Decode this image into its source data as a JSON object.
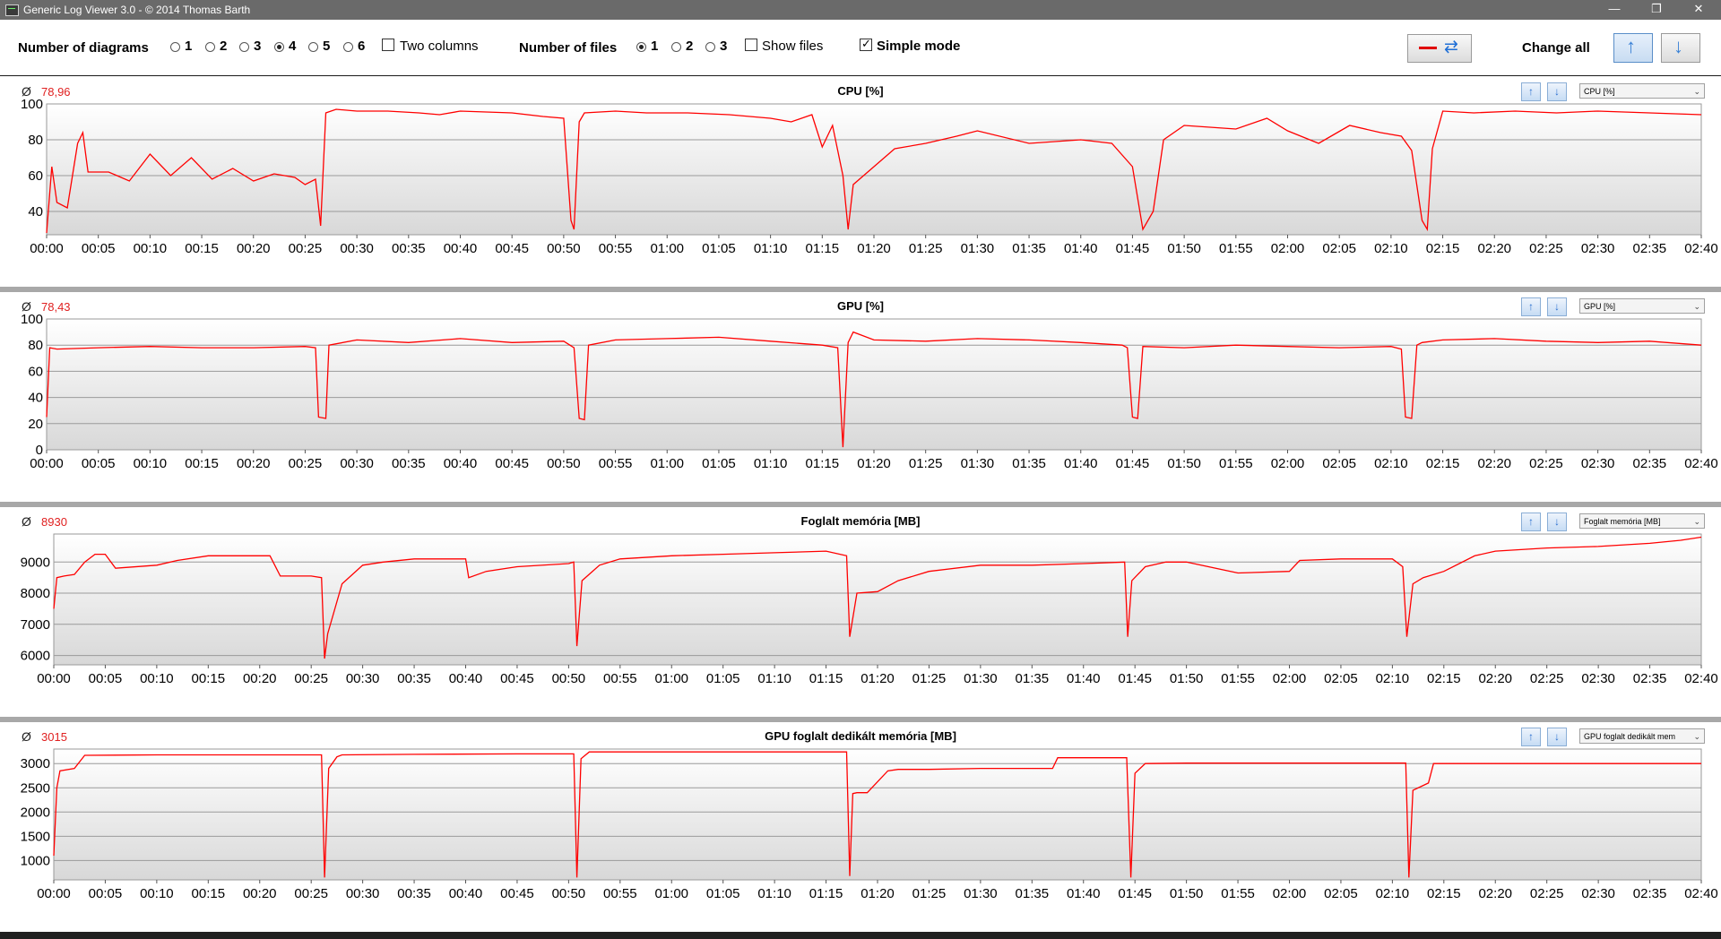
{
  "window": {
    "title": "Generic Log Viewer 3.0 - © 2014 Thomas Barth",
    "minimize": "—",
    "maximize": "❐",
    "close": "✕"
  },
  "toolbar": {
    "diagrams_label": "Number of diagrams",
    "diagram_options": [
      "1",
      "2",
      "3",
      "4",
      "5",
      "6"
    ],
    "diagram_selected": "4",
    "two_columns_label": "Two columns",
    "two_columns_checked": false,
    "files_label": "Number of files",
    "file_options": [
      "1",
      "2",
      "3"
    ],
    "file_selected": "1",
    "show_files_label": "Show files",
    "show_files_checked": false,
    "simple_mode_label": "Simple mode",
    "simple_mode_checked": true,
    "change_all_label": "Change all"
  },
  "colors": {
    "series": "#ff0000",
    "avg": "#e02020",
    "grid": "#9a9a9a",
    "separator": "#a8a8a8"
  },
  "avg_symbol": "Ø",
  "time_ticks": [
    "00:00",
    "00:05",
    "00:10",
    "00:15",
    "00:20",
    "00:25",
    "00:30",
    "00:35",
    "00:40",
    "00:45",
    "00:50",
    "00:55",
    "01:00",
    "01:05",
    "01:10",
    "01:15",
    "01:20",
    "01:25",
    "01:30",
    "01:35",
    "01:40",
    "01:45",
    "01:50",
    "01:55",
    "02:00",
    "02:05",
    "02:10",
    "02:15",
    "02:20",
    "02:25",
    "02:30",
    "02:35",
    "02:40"
  ],
  "panels": [
    {
      "title": "CPU [%]",
      "avg": "78,96",
      "combo": "CPU [%]"
    },
    {
      "title": "GPU [%]",
      "avg": "78,43",
      "combo": "GPU [%]"
    },
    {
      "title": "Foglalt memória [MB]",
      "avg": "8930",
      "combo": "Foglalt memória [MB]"
    },
    {
      "title": "GPU foglalt dedikált memória [MB]",
      "avg": "3015",
      "combo": "GPU foglalt dedikált mem"
    }
  ],
  "chart_data": [
    {
      "type": "line",
      "title": "CPU [%]",
      "x_unit": "minutes",
      "ylim": [
        27,
        100
      ],
      "yticks": [
        40,
        60,
        80,
        100
      ],
      "grid": true,
      "series": [
        {
          "name": "CPU [%]",
          "x": [
            0,
            0.5,
            1,
            2,
            3,
            3.5,
            4,
            6,
            8,
            10,
            12,
            14,
            16,
            18,
            20,
            22,
            24,
            25,
            26,
            26.5,
            27,
            28,
            30,
            33,
            36,
            38,
            40,
            45,
            48,
            50,
            50.7,
            51,
            51.5,
            52,
            55,
            58,
            62,
            66,
            70,
            72,
            74,
            75,
            76,
            77,
            77.5,
            78,
            80,
            82,
            85,
            88,
            90,
            95,
            100,
            103,
            105,
            106,
            107,
            108,
            110,
            115,
            118,
            120,
            123,
            126,
            129,
            131,
            132,
            133,
            133.5,
            134,
            135,
            138,
            142,
            146,
            150,
            155,
            160
          ],
          "values": [
            28,
            65,
            45,
            42,
            78,
            84,
            62,
            62,
            57,
            72,
            60,
            70,
            58,
            64,
            57,
            61,
            59,
            55,
            58,
            32,
            95,
            97,
            96,
            96,
            95,
            94,
            96,
            95,
            93,
            92,
            35,
            30,
            90,
            95,
            96,
            95,
            95,
            94,
            92,
            90,
            94,
            76,
            88,
            60,
            30,
            55,
            65,
            75,
            78,
            82,
            85,
            78,
            80,
            78,
            65,
            30,
            40,
            80,
            88,
            86,
            92,
            85,
            78,
            88,
            84,
            82,
            74,
            35,
            30,
            75,
            96,
            95,
            96,
            95,
            96,
            95,
            94
          ]
        }
      ]
    },
    {
      "type": "line",
      "title": "GPU [%]",
      "x_unit": "minutes",
      "ylim": [
        0,
        100
      ],
      "yticks": [
        0,
        20,
        40,
        60,
        80,
        100
      ],
      "grid": true,
      "series": [
        {
          "name": "GPU [%]",
          "x": [
            0,
            0.3,
            1,
            5,
            10,
            15,
            20,
            25,
            26,
            26.3,
            27,
            27.3,
            30,
            35,
            40,
            45,
            50,
            51,
            51.5,
            52,
            52.4,
            55,
            60,
            65,
            70,
            75,
            76.5,
            77,
            77.5,
            78,
            80,
            85,
            90,
            95,
            100,
            104,
            104.5,
            105,
            105.5,
            106,
            110,
            115,
            120,
            125,
            130,
            131,
            131.4,
            132,
            132.5,
            133,
            135,
            140,
            145,
            150,
            155,
            160
          ],
          "values": [
            25,
            78,
            77,
            78,
            79,
            78,
            78,
            79,
            78,
            25,
            24,
            80,
            84,
            82,
            85,
            82,
            83,
            78,
            24,
            23,
            80,
            84,
            85,
            86,
            83,
            80,
            78,
            2,
            82,
            90,
            84,
            83,
            85,
            84,
            82,
            80,
            78,
            25,
            24,
            79,
            78,
            80,
            79,
            78,
            79,
            77,
            25,
            24,
            80,
            82,
            84,
            85,
            83,
            82,
            83,
            80
          ]
        }
      ]
    },
    {
      "type": "line",
      "title": "Foglalt memória [MB]",
      "x_unit": "minutes",
      "ylim": [
        5700,
        9900
      ],
      "yticks": [
        6000,
        7000,
        8000,
        9000
      ],
      "grid": true,
      "series": [
        {
          "name": "Foglalt memória [MB]",
          "x": [
            0,
            0.3,
            1,
            2,
            3,
            4,
            5,
            6,
            10,
            12,
            15,
            20,
            21,
            22,
            24,
            25,
            26,
            26.3,
            26.6,
            28,
            30,
            32,
            35,
            40,
            40.3,
            42,
            45,
            50,
            50.5,
            50.8,
            51.3,
            53,
            55,
            60,
            65,
            70,
            75,
            77,
            77.3,
            78,
            80,
            82,
            85,
            90,
            95,
            100,
            104,
            104.3,
            104.7,
            106,
            108,
            110,
            115,
            120,
            121,
            125,
            130,
            131,
            131.4,
            132,
            133,
            135,
            138,
            140,
            145,
            150,
            155,
            158,
            160
          ],
          "values": [
            7500,
            8500,
            8550,
            8600,
            9000,
            9250,
            9250,
            8800,
            8900,
            9050,
            9200,
            9200,
            9200,
            8550,
            8550,
            8550,
            8500,
            5900,
            6700,
            8300,
            8900,
            9000,
            9100,
            9100,
            8500,
            8700,
            8850,
            8950,
            9000,
            6300,
            8400,
            8900,
            9100,
            9200,
            9250,
            9300,
            9350,
            9200,
            6600,
            8000,
            8050,
            8400,
            8700,
            8900,
            8900,
            8950,
            9000,
            6600,
            8400,
            8850,
            9000,
            9000,
            8650,
            8700,
            9050,
            9100,
            9100,
            8850,
            6600,
            8300,
            8500,
            8700,
            9200,
            9350,
            9450,
            9500,
            9600,
            9700,
            9800
          ]
        }
      ]
    },
    {
      "type": "line",
      "title": "GPU foglalt dedikált memória [MB]",
      "x_unit": "minutes",
      "ylim": [
        600,
        3300
      ],
      "yticks": [
        1000,
        1500,
        2000,
        2500,
        3000
      ],
      "grid": true,
      "series": [
        {
          "name": "GPU foglalt dedikált memória [MB]",
          "x": [
            0,
            0.3,
            0.6,
            2,
            3,
            10,
            20,
            25,
            26,
            26.3,
            26.7,
            27.5,
            28,
            35,
            45,
            50,
            50.5,
            50.8,
            51.2,
            52,
            60,
            70,
            77,
            77.3,
            77.6,
            78,
            79,
            81,
            82,
            85,
            90,
            97,
            97.5,
            104,
            104.2,
            104.6,
            105,
            106,
            110,
            115,
            120,
            131,
            131.3,
            131.6,
            132,
            133,
            133.5,
            134,
            140,
            150,
            160
          ],
          "values": [
            1100,
            2500,
            2850,
            2900,
            3170,
            3180,
            3180,
            3180,
            3180,
            650,
            2900,
            3140,
            3180,
            3190,
            3200,
            3200,
            3200,
            650,
            3100,
            3240,
            3240,
            3240,
            3240,
            680,
            2380,
            2400,
            2400,
            2850,
            2880,
            2880,
            2900,
            2900,
            3120,
            3120,
            3120,
            650,
            2800,
            3000,
            3010,
            3010,
            3010,
            3010,
            3010,
            650,
            2450,
            2550,
            2600,
            3000,
            3000,
            3000,
            3000
          ]
        }
      ]
    }
  ]
}
